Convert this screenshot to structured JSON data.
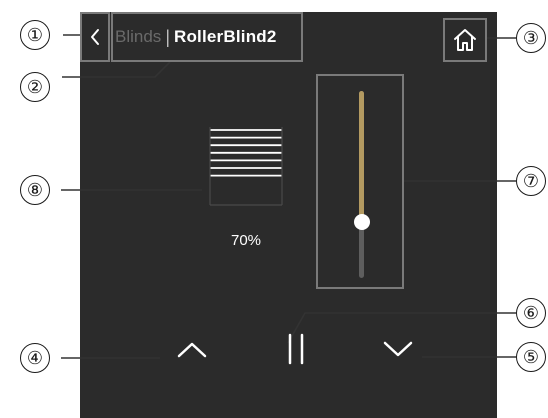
{
  "header": {
    "back_icon": "chevron-left-icon",
    "breadcrumb_parent": "Blinds",
    "breadcrumb_separator": "|",
    "breadcrumb_current": "RollerBlind2",
    "home_icon": "home-icon"
  },
  "blind": {
    "icon": "roller-blind-icon",
    "position_label": "70%",
    "position_fraction": 0.7
  },
  "controls": {
    "up_icon": "chevron-up-icon",
    "stop_icon": "pause-icon",
    "down_icon": "chevron-down-icon"
  },
  "callouts": [
    "①",
    "②",
    "③",
    "④",
    "⑤",
    "⑥",
    "⑦",
    "⑧"
  ],
  "colors": {
    "background": "#2b2b2b",
    "outline": "#7a7a7a",
    "slider_fill": "#b39a61",
    "slider_track": "#5e5e5e",
    "text": "#ffffff",
    "text_dim": "#6a6a6a"
  }
}
